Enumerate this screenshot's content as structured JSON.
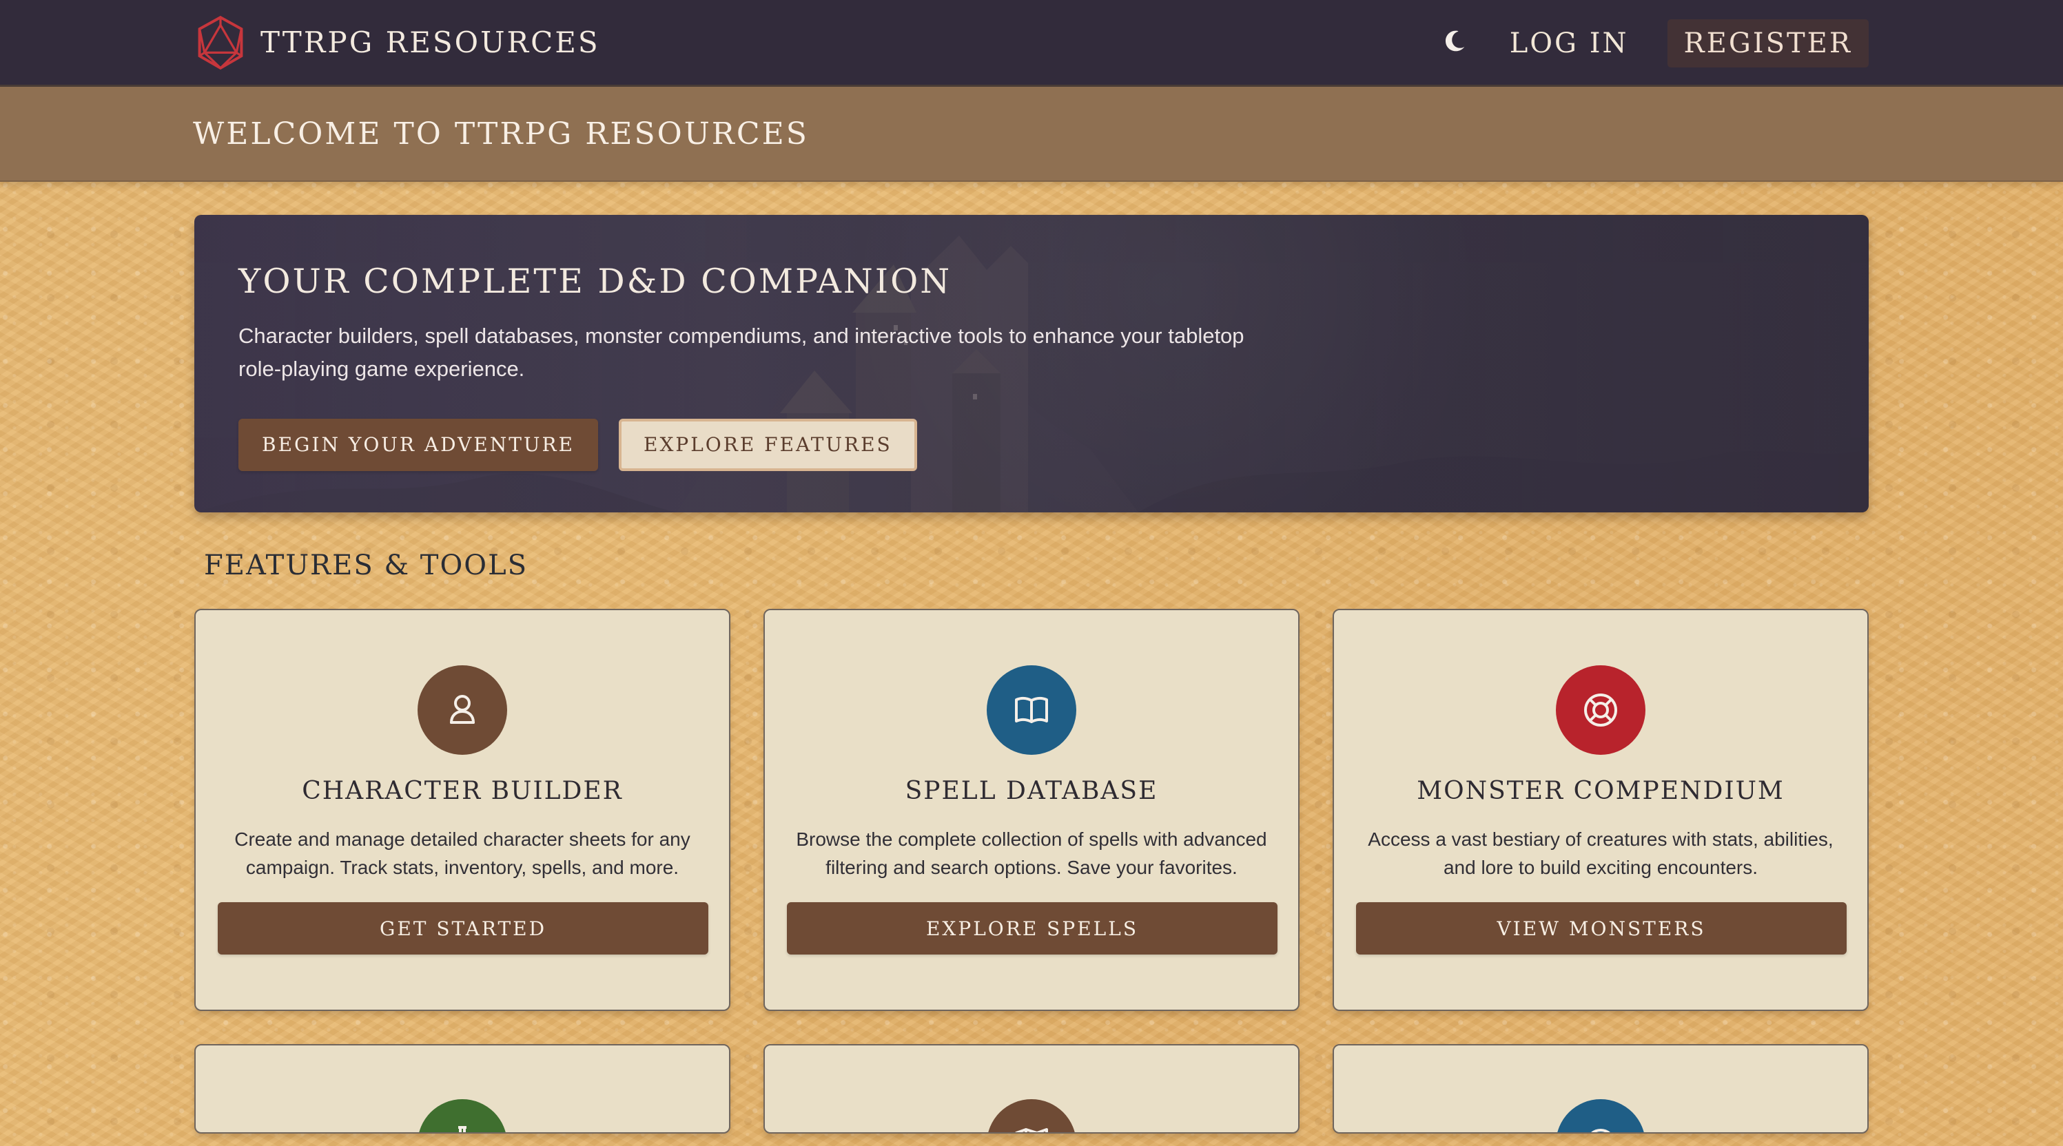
{
  "topbar": {
    "brand": "TTRPG RESOURCES",
    "login": "LOG IN",
    "register": "REGISTER",
    "theme_icon": "moon-icon",
    "logo_icon": "d20-icon"
  },
  "welcome": {
    "title": "WELCOME TO TTRPG RESOURCES"
  },
  "hero": {
    "title": "YOUR COMPLETE D&D COMPANION",
    "description": "Character builders, spell databases, monster compendiums, and interactive tools to enhance your tabletop role-playing game experience.",
    "primary_button": "BEGIN YOUR ADVENTURE",
    "secondary_button": "EXPLORE FEATURES"
  },
  "features": {
    "title": "FEATURES & TOOLS",
    "cards": [
      {
        "title": "CHARACTER BUILDER",
        "description": "Create and manage detailed character sheets for any campaign. Track stats, inventory, spells, and more.",
        "button": "GET STARTED",
        "icon": "user-icon",
        "color": "#6f4b35"
      },
      {
        "title": "SPELL DATABASE",
        "description": "Browse the complete collection of spells with advanced filtering and search options. Save your favorites.",
        "button": "EXPLORE SPELLS",
        "icon": "book-icon",
        "color": "#1f5e86"
      },
      {
        "title": "MONSTER COMPENDIUM",
        "description": "Access a vast bestiary of creatures with stats, abilities, and lore to build exciting encounters.",
        "button": "VIEW MONSTERS",
        "icon": "lifebuoy-icon",
        "color": "#b8232c"
      }
    ],
    "partial_cards": [
      {
        "icon": "flask-icon",
        "color": "#3f6f2f"
      },
      {
        "icon": "map-icon",
        "color": "#6f4b35"
      },
      {
        "icon": "clock-icon",
        "color": "#1f5e86"
      }
    ]
  }
}
